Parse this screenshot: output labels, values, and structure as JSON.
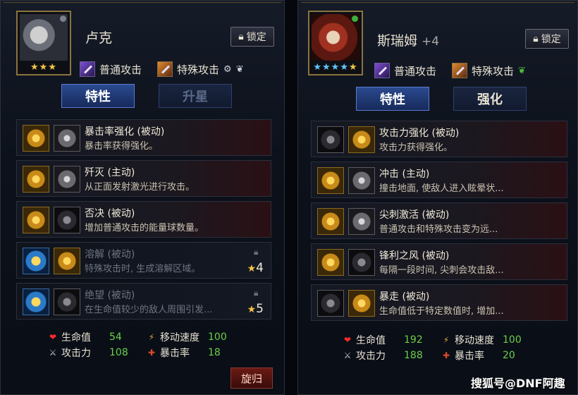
{
  "left": {
    "name": "卢克",
    "stars": "★★★",
    "lock_label": "锁定",
    "normal_attack": "普通攻击",
    "special_attack": "特殊攻击",
    "tabs": [
      "特性",
      "升星"
    ],
    "skills": [
      {
        "name": "暴击率强化 (被动)",
        "desc": "暴击率获得强化。",
        "locked": false
      },
      {
        "name": "歼灭 (主动)",
        "desc": "从正面发射激光进行攻击。",
        "locked": false
      },
      {
        "name": "否决 (被动)",
        "desc": "增加普通攻击的能量球数量。",
        "locked": false
      },
      {
        "name": "溶解 (被动)",
        "desc": "特殊攻击时, 生成溶解区域。",
        "locked": true,
        "star_req": "4"
      },
      {
        "name": "绝望 (被动)",
        "desc": "在生命值较少的敌人周围引发...",
        "locked": true,
        "star_req": "5"
      }
    ],
    "stats": {
      "hp_label": "生命值",
      "hp": "54",
      "speed_label": "移动速度",
      "speed": "100",
      "atk_label": "攻击力",
      "atk": "108",
      "crit_label": "暴击率",
      "crit": "18"
    },
    "return_label": "旋归"
  },
  "right": {
    "name": "斯瑞姆",
    "plus": "+4",
    "stars_blue": "★★★★",
    "stars_gold": "★",
    "lock_label": "锁定",
    "normal_attack": "普通攻击",
    "special_attack": "特殊攻击",
    "tabs": [
      "特性",
      "强化"
    ],
    "skills": [
      {
        "name": "攻击力强化 (被动)",
        "desc": "攻击力获得强化。"
      },
      {
        "name": "冲击 (主动)",
        "desc": "撞击地面, 使敌人进入眩晕状..."
      },
      {
        "name": "尖刺激活 (被动)",
        "desc": "普通攻击和特殊攻击变为远..."
      },
      {
        "name": "锋利之风 (被动)",
        "desc": "每隔一段时间, 尖刺会攻击敌..."
      },
      {
        "name": "暴走 (被动)",
        "desc": "生命值低于特定数值时, 增加..."
      }
    ],
    "stats": {
      "hp_label": "生命值",
      "hp": "192",
      "speed_label": "移动速度",
      "speed": "100",
      "atk_label": "攻击力",
      "atk": "188",
      "crit_label": "暴击率",
      "crit": "20"
    }
  },
  "watermark": "搜狐号@DNF阿趣"
}
